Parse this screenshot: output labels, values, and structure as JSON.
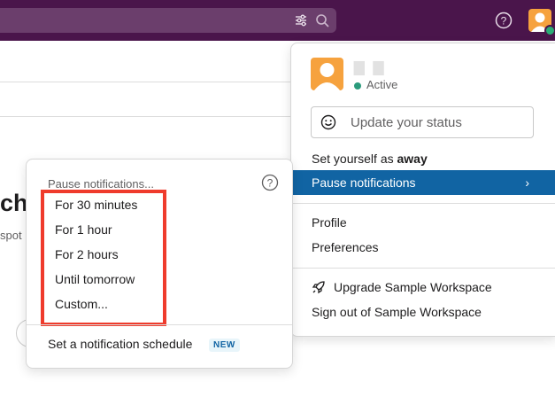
{
  "colors": {
    "topbar": "#4a154b",
    "highlight": "#1164a3",
    "annotation_box": "#ef3b2c",
    "presence": "#2b9b7c"
  },
  "background": {
    "heading_fragment": "cha",
    "sub_fragment": "spot"
  },
  "user_menu": {
    "status": "Active",
    "status_placeholder": "Update your status",
    "set_away_prefix": "Set yourself as ",
    "set_away_bold": "away",
    "pause_notifications": "Pause notifications",
    "pause_chevron": "›",
    "profile": "Profile",
    "preferences": "Preferences",
    "upgrade": "Upgrade Sample Workspace",
    "sign_out": "Sign out of Sample Workspace"
  },
  "pause_menu": {
    "title": "Pause notifications...",
    "options": [
      "For 30 minutes",
      "For 1 hour",
      "For 2 hours",
      "Until tomorrow",
      "Custom..."
    ],
    "schedule": "Set a notification schedule",
    "schedule_badge": "NEW"
  },
  "icons": [
    "filter-icon",
    "search-icon",
    "help-icon",
    "avatar",
    "smiley-icon",
    "chevron-right-icon",
    "rocket-icon"
  ]
}
